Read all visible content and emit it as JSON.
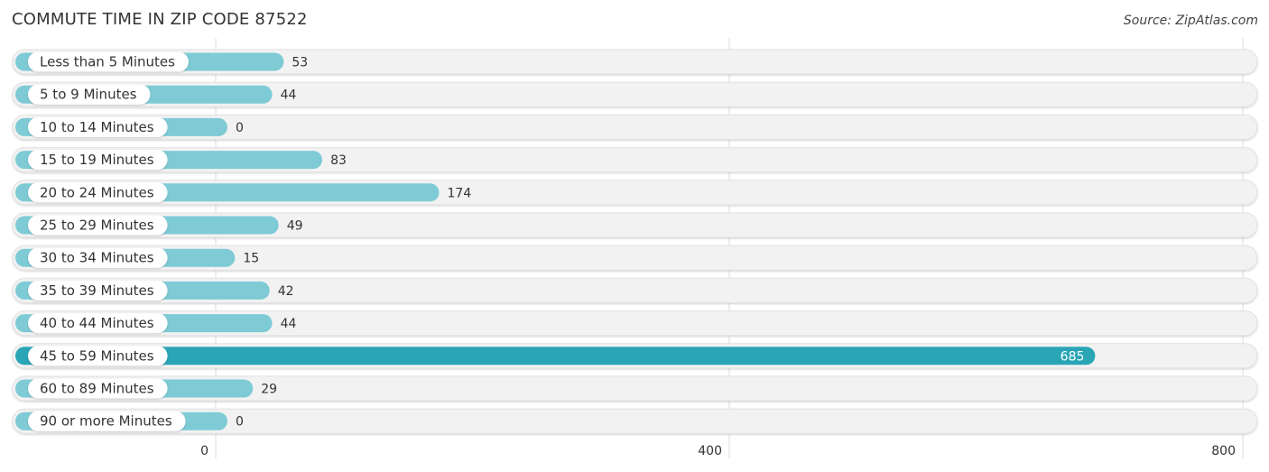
{
  "header": {
    "title": "COMMUTE TIME IN ZIP CODE 87522",
    "source": "Source: ZipAtlas.com"
  },
  "chart_data": {
    "type": "bar",
    "orientation": "horizontal",
    "title": "COMMUTE TIME IN ZIP CODE 87522",
    "xlabel": "",
    "ylabel": "",
    "xlim": [
      0,
      800
    ],
    "xticks": [
      0,
      400,
      800
    ],
    "grid": true,
    "categories": [
      "Less than 5 Minutes",
      "5 to 9 Minutes",
      "10 to 14 Minutes",
      "15 to 19 Minutes",
      "20 to 24 Minutes",
      "25 to 29 Minutes",
      "30 to 34 Minutes",
      "35 to 39 Minutes",
      "40 to 44 Minutes",
      "45 to 59 Minutes",
      "60 to 89 Minutes",
      "90 or more Minutes"
    ],
    "values": [
      53,
      44,
      0,
      83,
      174,
      49,
      15,
      42,
      44,
      685,
      29,
      0
    ],
    "highlight_index": 9,
    "colors": {
      "bar": "#7ecbd6",
      "bar_highlight": "#2aa5b5",
      "track": "#f2f2f2",
      "grid": "#dddddd"
    }
  }
}
